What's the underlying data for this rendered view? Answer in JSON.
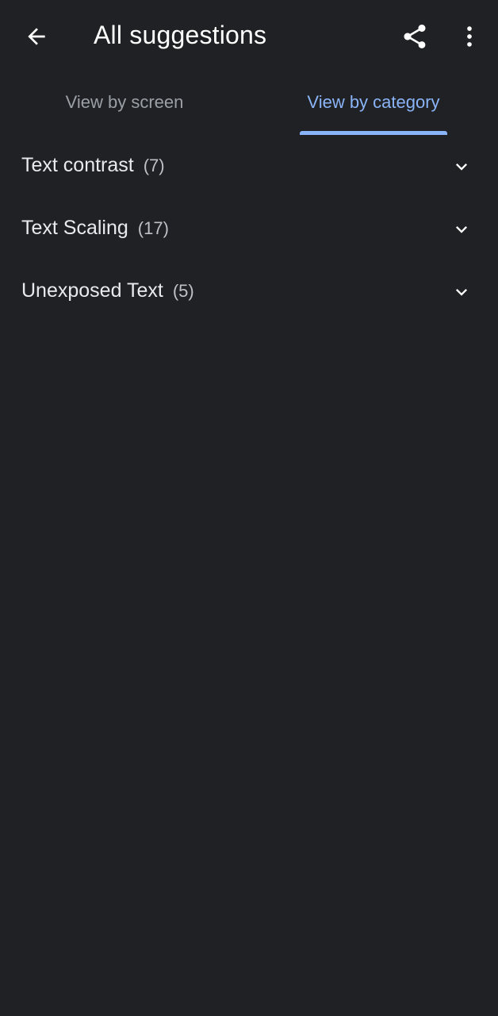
{
  "appbar": {
    "title": "All suggestions",
    "back_icon": "arrow-back-icon",
    "share_icon": "share-icon",
    "more_icon": "more-vert-icon"
  },
  "tabs": [
    {
      "label": "View by screen",
      "selected": false
    },
    {
      "label": "View by category",
      "selected": true
    }
  ],
  "categories": [
    {
      "label": "Text contrast",
      "count": "(7)"
    },
    {
      "label": "Text Scaling",
      "count": "(17)"
    },
    {
      "label": "Unexposed Text",
      "count": "(5)"
    }
  ],
  "colors": {
    "background": "#202124",
    "accent": "#8ab4f8",
    "text_primary": "#e8eaed",
    "text_secondary": "#9aa0a6"
  }
}
